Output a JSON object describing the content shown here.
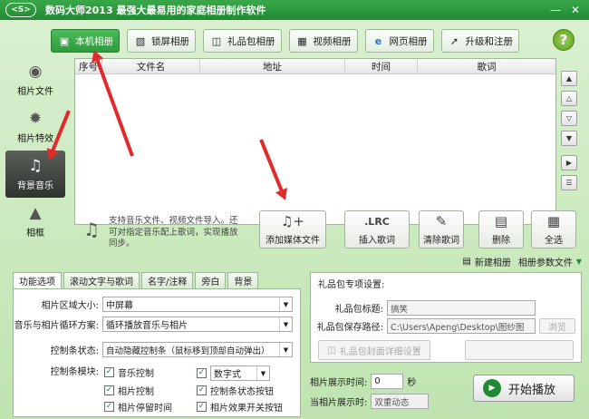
{
  "window": {
    "logo_text": "<S>",
    "title": "数码大师2013    最强大最易用的家庭相册制作软件",
    "min_icon": "minimize-icon",
    "close_icon": "close-icon"
  },
  "top_tabs": [
    {
      "label": "本机相册",
      "icon": "photo-icon",
      "active": true
    },
    {
      "label": "锁屏相册",
      "icon": "monitor-icon",
      "active": false
    },
    {
      "label": "礼品包相册",
      "icon": "gift-icon",
      "active": false
    },
    {
      "label": "视频相册",
      "icon": "film-icon",
      "active": false
    },
    {
      "label": "网页相册",
      "icon": "browser-icon",
      "active": false
    },
    {
      "label": "升级和注册",
      "icon": "upgrade-icon",
      "active": false
    }
  ],
  "help_label": "?",
  "sidebar": [
    {
      "label": "相片文件",
      "icon": "camera-icon",
      "active": false
    },
    {
      "label": "相片特效",
      "icon": "effects-icon",
      "active": false
    },
    {
      "label": "背景音乐",
      "icon": "music-note-icon",
      "active": true
    },
    {
      "label": "相框",
      "icon": "frame-icon",
      "active": false
    }
  ],
  "list": {
    "columns": [
      "序号",
      "文件名",
      "地址",
      "时间",
      "歌词"
    ]
  },
  "hint_text": "支持音乐文件、视频文件导入。还可对指定音乐配上歌词，实现播放同步。",
  "toolbar": {
    "add_media": "添加媒体文件",
    "insert_lyrics_icon": ".LRC",
    "insert_lyrics": "插入歌词",
    "clear_lyrics": "清除歌词",
    "delete": "删除",
    "select_all": "全选"
  },
  "strip": {
    "new_album": "新建相册",
    "album_params": "相册参数文件"
  },
  "lower_tabs": [
    "功能选项",
    "滚动文字与歌词",
    "名字/注释",
    "旁白",
    "背景"
  ],
  "options": {
    "photo_area_label": "相片区域大小:",
    "photo_area_value": "中屏幕",
    "loop_label": "音乐与相片循环方案:",
    "loop_value": "循环播放音乐与相片",
    "controlbar_state_label": "控制条状态:",
    "controlbar_state_value": "自动隐藏控制条（鼠标移到顶部自动弹出）",
    "controlbar_module_label": "控制条模块:",
    "checks": [
      {
        "label": "音乐控制",
        "checked": true
      },
      {
        "label": "数字式",
        "checked": true
      },
      {
        "label": "相片控制",
        "checked": true
      },
      {
        "label": "控制条状态按钮",
        "checked": true
      },
      {
        "label": "相片停留时间",
        "checked": true
      },
      {
        "label": "相片效果开关按钮",
        "checked": true
      }
    ]
  },
  "gift": {
    "section_title": "礼品包专项设置:",
    "title_label": "礼品包标题:",
    "title_value": "搞笑",
    "path_label": "礼品包保存路径:",
    "path_value": "C:\\Users\\Apeng\\Desktop\\图纱图",
    "browse": "浏览",
    "cover_btn": "礼品包封面详细设置"
  },
  "playback": {
    "display_time_label": "相片展示时间:",
    "display_time_value": "0",
    "unit": "秒",
    "when_label": "当相片展示时:",
    "when_value": "双重动态",
    "play_button": "开始播放"
  }
}
